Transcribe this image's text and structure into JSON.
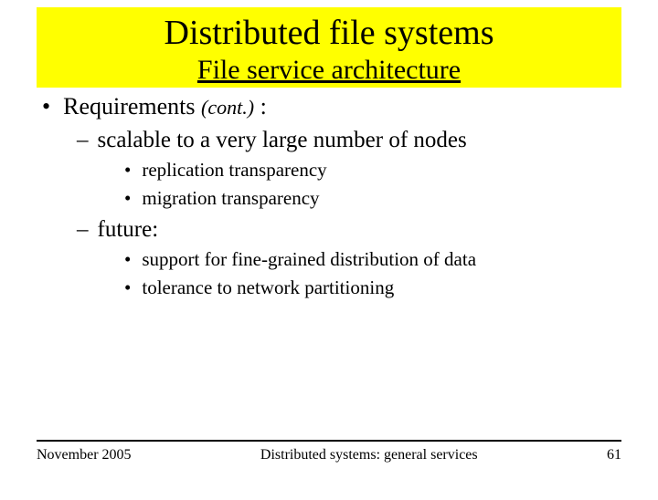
{
  "title": "Distributed file systems",
  "subtitle": "File service architecture",
  "content": {
    "b1_label": "Requirements",
    "b1_note": "(cont.)",
    "b1_colon": " :",
    "b2_a": "scalable to a very large number of nodes",
    "b3_a1": "replication transparency",
    "b3_a2": "migration transparency",
    "b2_b": "future:",
    "b3_b1": "support for fine-grained distribution of data",
    "b3_b2": "tolerance to network partitioning"
  },
  "footer": {
    "date": "November 2005",
    "center": "Distributed systems: general services",
    "page": "61"
  }
}
